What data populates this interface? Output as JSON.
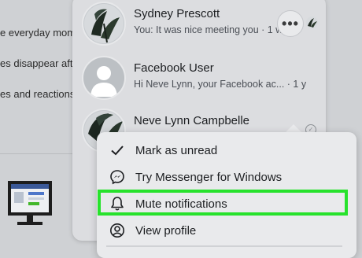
{
  "background_feed": {
    "lines": [
      "e everyday mome",
      "es disappear after",
      "es and reactions a"
    ]
  },
  "conversations": [
    {
      "name": "Sydney Prescott",
      "snippet": "You: It was nice meeting you · 1 w",
      "avatar": "plant-avatar"
    },
    {
      "name": "Facebook User",
      "snippet": "Hi Neve Lynn, your Facebook ac... · 1 y",
      "avatar": "default-user-avatar"
    },
    {
      "name": "Neve Lynn Campbelle",
      "snippet": "",
      "avatar": "plant-avatar"
    }
  ],
  "more_button": {
    "label": "•••"
  },
  "context_menu": {
    "items": [
      {
        "label": "Mark as unread",
        "icon": "check-icon"
      },
      {
        "label": "Try Messenger for Windows",
        "icon": "messenger-icon"
      },
      {
        "label": "Mute notifications",
        "icon": "bell-icon"
      },
      {
        "label": "View profile",
        "icon": "user-circle-icon"
      }
    ],
    "highlighted_item": "Mute notifications"
  },
  "colors": {
    "highlight": "#27e22c",
    "menu_bg": "#e9eaec",
    "panel_bg": "#dcdde0",
    "text": "#1c1e21"
  }
}
